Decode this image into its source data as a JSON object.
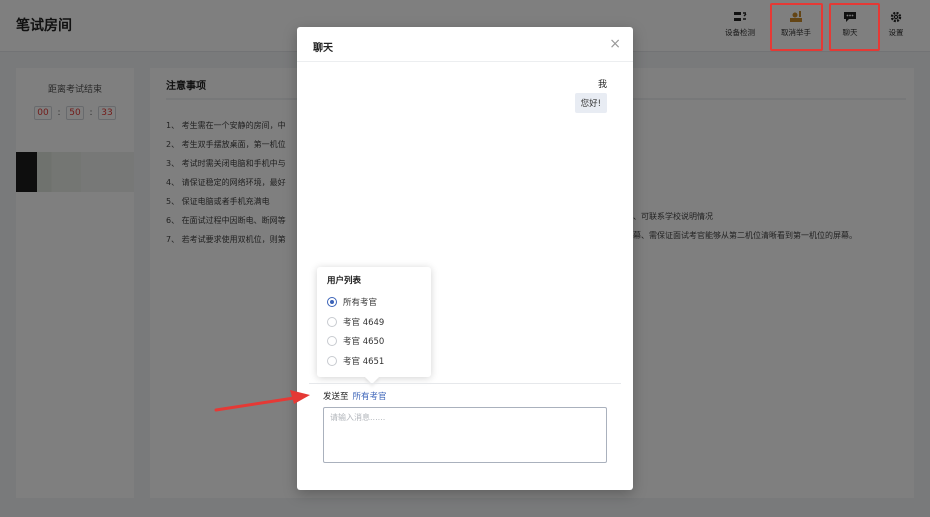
{
  "page": {
    "title": "笔试房间"
  },
  "toolbar": {
    "device_check": "设备检测",
    "cancel_hand": "取消举手",
    "chat": "聊天",
    "settings": "设置"
  },
  "countdown": {
    "label": "距离考试结束",
    "hours": "00",
    "minutes": "50",
    "seconds": "33"
  },
  "notice": {
    "title": "注意事项",
    "items": [
      "1、 考生需在一个安静的房间，中",
      "2、 考生双手摆放桌面，第一机位",
      "3、 考试时需关闭电脑和手机中与",
      "4、 请保证稳定的网络环境，最好",
      "5、 保证电脑或者手机充满电",
      "6、 在面试过程中因断电、断网等",
      "7、 若考试要求使用双机位，则第"
    ],
    "tail_6": "长、可联系学校说明情况",
    "tail_7": "屏幕、需保证面试考官能够从第二机位清晰看到第一机位的屏幕。"
  },
  "chat_modal": {
    "title": "聊天",
    "close": "×",
    "messages": [
      {
        "sender": "我",
        "text": "您好!"
      }
    ],
    "user_list": {
      "title": "用户列表",
      "options": [
        "所有考官",
        "考官 4649",
        "考官 4650",
        "考官 4651"
      ],
      "selected": "所有考官"
    },
    "send_to_label": "发送至",
    "send_to_target": "所有考官",
    "input_placeholder": "请输入消息......",
    "input_value": ""
  },
  "colors": {
    "accent": "#3b63b8",
    "highlight": "#e53935",
    "countdown": "#e53935"
  }
}
